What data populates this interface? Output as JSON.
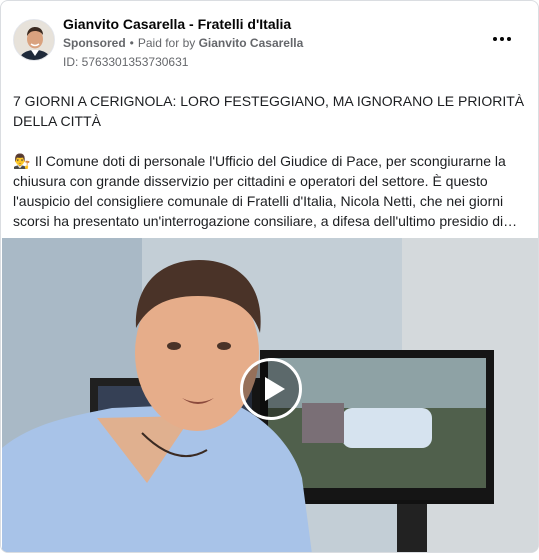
{
  "header": {
    "page_name": "Gianvito Casarella - Fratelli d'Italia",
    "sponsored": "Sponsored",
    "separator": "•",
    "paid_for_by": "Paid for by",
    "payer": "Gianvito Casarella",
    "ad_id": "ID: 5763301353730631"
  },
  "post": {
    "title": "7 GIORNI A CERIGNOLA: LORO FESTEGGIANO, MA IGNORANO LE PRIORITÀ DELLA CITTÀ",
    "emoji": "👨‍⚖️",
    "body": "Il Comune doti di personale l'Ufficio del Giudice di Pace, per scongiurarne la chiusura con grande disservizio per cittadini e operatori del settore. È questo l'auspicio del consigliere comunale di Fratelli d'Italia, Nicola Netti, che nei giorni scorsi ha presentato un'interrogazione consiliare, a difesa dell'ultimo presidio di…"
  },
  "icons": {
    "more": "more-options-icon",
    "play": "play-icon"
  }
}
